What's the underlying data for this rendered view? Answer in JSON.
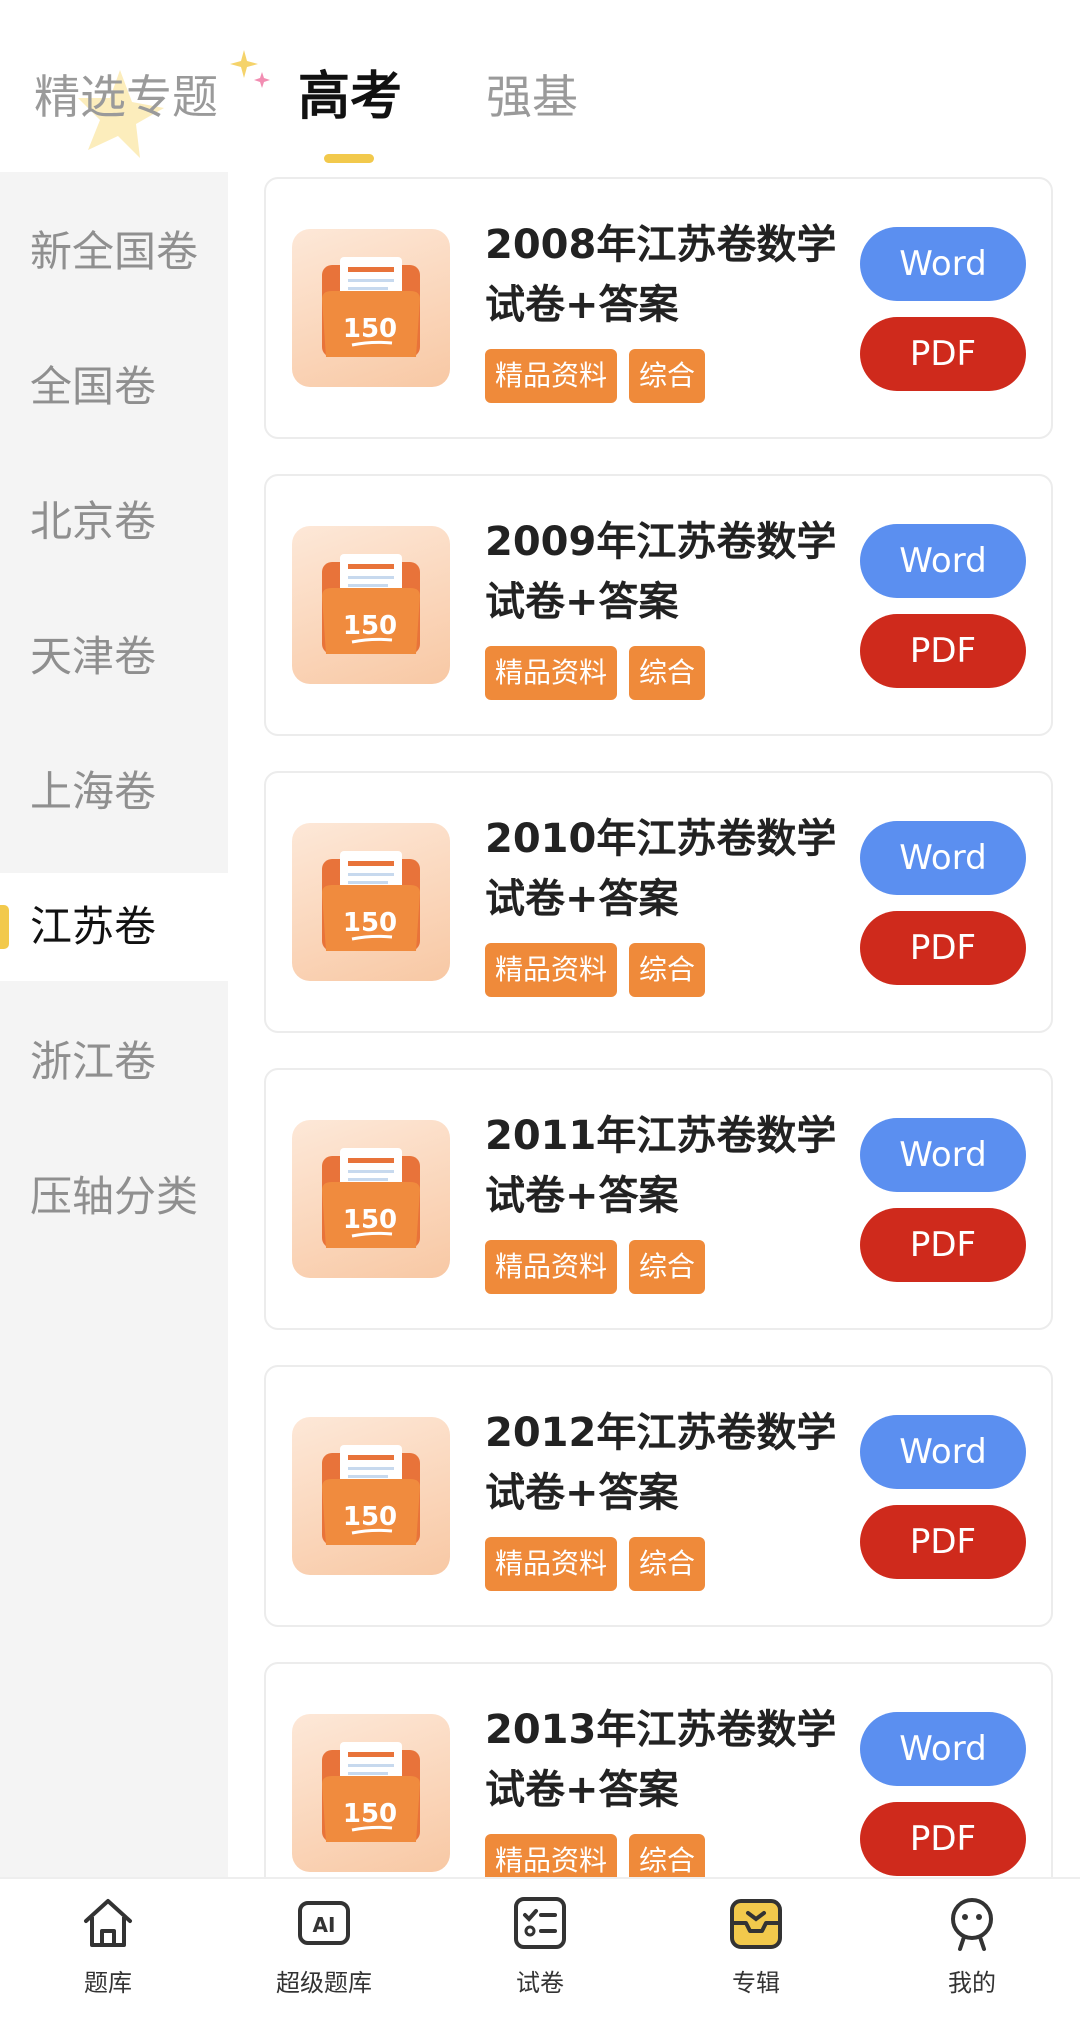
{
  "top_tabs": [
    {
      "label": "精选专题"
    },
    {
      "label": "高考"
    },
    {
      "label": "强基"
    }
  ],
  "sidebar": {
    "items": [
      {
        "label": "新全国卷"
      },
      {
        "label": "全国卷"
      },
      {
        "label": "北京卷"
      },
      {
        "label": "天津卷"
      },
      {
        "label": "上海卷"
      },
      {
        "label": "江苏卷"
      },
      {
        "label": "浙江卷"
      },
      {
        "label": "压轴分类"
      }
    ],
    "active": "江苏卷"
  },
  "cards": [
    {
      "title": "2008年江苏卷数学试卷+答案",
      "thumb_number": "150",
      "tags": [
        "精品资料",
        "综合"
      ],
      "word_label": "Word",
      "pdf_label": "PDF"
    },
    {
      "title": "2009年江苏卷数学试卷+答案",
      "thumb_number": "150",
      "tags": [
        "精品资料",
        "综合"
      ],
      "word_label": "Word",
      "pdf_label": "PDF"
    },
    {
      "title": "2010年江苏卷数学试卷+答案",
      "thumb_number": "150",
      "tags": [
        "精品资料",
        "综合"
      ],
      "word_label": "Word",
      "pdf_label": "PDF"
    },
    {
      "title": "2011年江苏卷数学试卷+答案",
      "thumb_number": "150",
      "tags": [
        "精品资料",
        "综合"
      ],
      "word_label": "Word",
      "pdf_label": "PDF"
    },
    {
      "title": "2012年江苏卷数学试卷+答案",
      "thumb_number": "150",
      "tags": [
        "精品资料",
        "综合"
      ],
      "word_label": "Word",
      "pdf_label": "PDF"
    },
    {
      "title": "2013年江苏卷数学试卷+答案",
      "thumb_number": "150",
      "tags": [
        "精品资料",
        "综合"
      ],
      "word_label": "Word",
      "pdf_label": "PDF"
    }
  ],
  "bottom_nav": [
    {
      "label": "题库",
      "icon": "home-icon"
    },
    {
      "label": "超级题库",
      "icon": "ai-icon"
    },
    {
      "label": "试卷",
      "icon": "checklist-icon"
    },
    {
      "label": "专辑",
      "icon": "inbox-icon",
      "active": true
    },
    {
      "label": "我的",
      "icon": "profile-icon"
    }
  ],
  "colors": {
    "accent_yellow": "#f2c94c",
    "word_button": "#5b8ff0",
    "pdf_button": "#cf2a1c",
    "tag_orange": "#ef8a3a"
  }
}
